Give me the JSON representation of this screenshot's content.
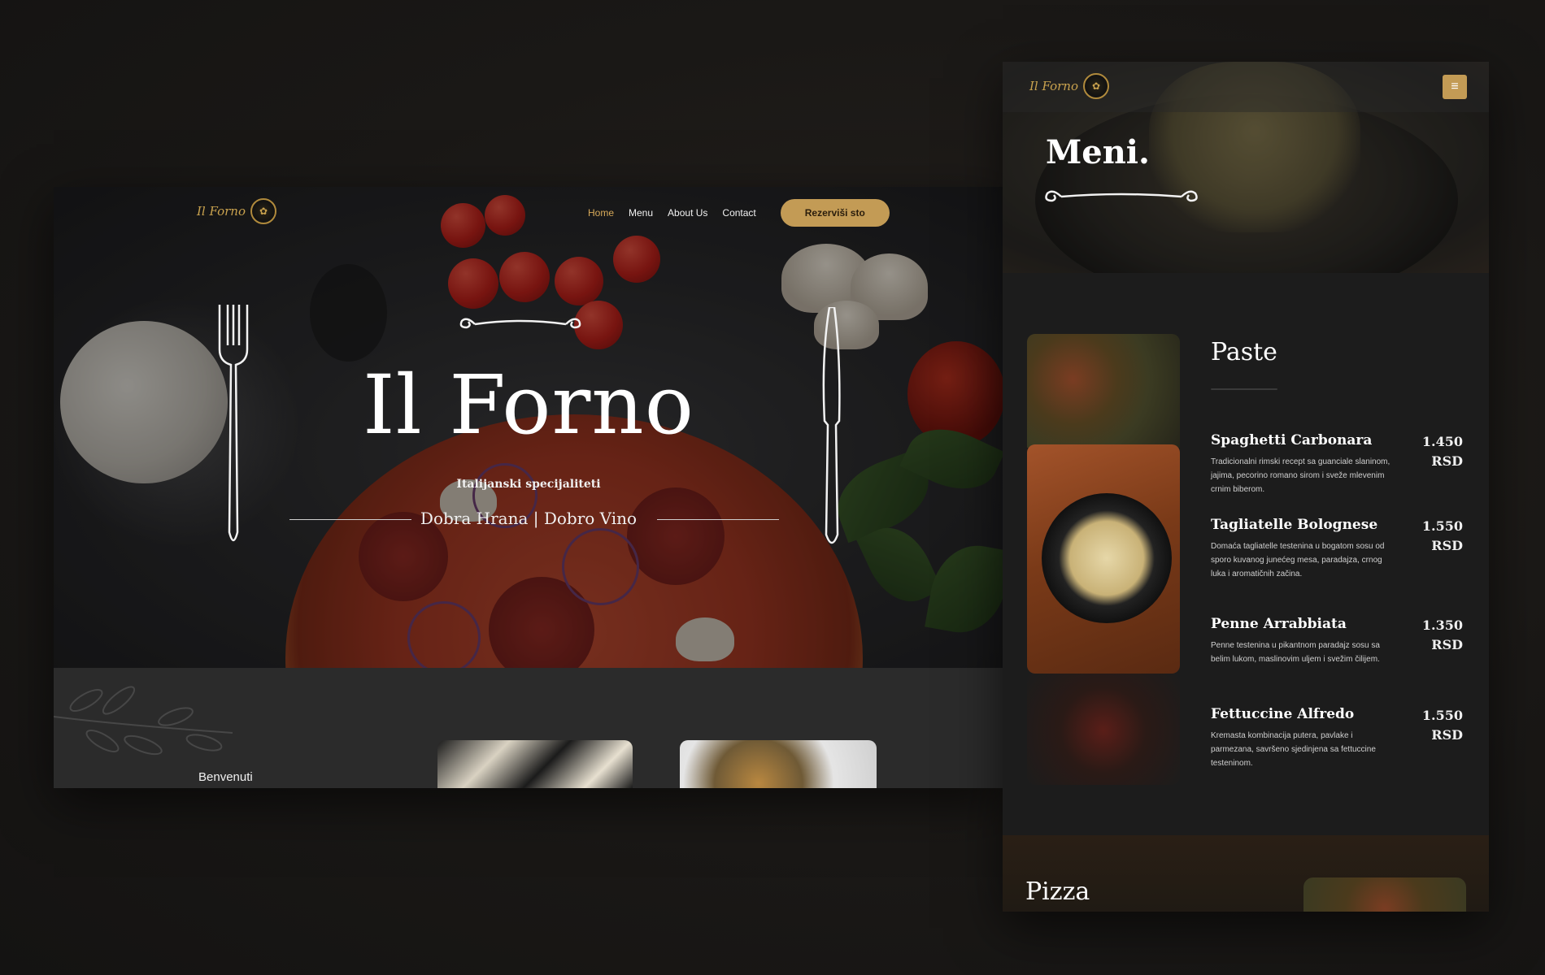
{
  "brand": {
    "logo_text": "Il Forno"
  },
  "desktop": {
    "nav": {
      "items": [
        {
          "label": "Home",
          "active": true
        },
        {
          "label": "Menu",
          "active": false
        },
        {
          "label": "About Us",
          "active": false
        },
        {
          "label": "Contact",
          "active": false
        }
      ],
      "cta_label": "Rezerviši sto"
    },
    "hero": {
      "title": "Il Forno",
      "subtitle": "Italijanski specijaliteti",
      "slogan": "Dobra Hrana | Dobro Vino"
    },
    "welcome": {
      "label": "Benvenuti"
    }
  },
  "mobile": {
    "page_title": "Meni.",
    "menu_button_icon": "hamburger-icon",
    "category": "Paste",
    "items": [
      {
        "name": "Spaghetti Carbonara",
        "desc": "Tradicionalni rimski recept sa guanciale slaninom, jajima, pecorino romano sirom i sveže mlevenim crnim biberom.",
        "price": "1.450",
        "currency": "RSD"
      },
      {
        "name": "Tagliatelle Bolognese",
        "desc": "Domaća tagliatelle testenina u bogatom sosu od sporo kuvanog junećeg mesa, paradajza, crnog luka i aromatičnih začina.",
        "price": "1.550",
        "currency": "RSD"
      },
      {
        "name": "Penne Arrabbiata",
        "desc": "Penne testenina u pikantnom paradajz sosu sa belim lukom, maslinovim uljem i svežim čilijem.",
        "price": "1.350",
        "currency": "RSD"
      },
      {
        "name": "Fettuccine Alfredo",
        "desc": "Kremasta kombinacija putera, pavlake i parmezana, savršeno sjedinjena sa fettuccine testeninom.",
        "price": "1.550",
        "currency": "RSD"
      }
    ],
    "next_category": "Pizza"
  },
  "colors": {
    "accent": "#c39b55",
    "active_nav": "#d8aa5a",
    "background": "#1a1816"
  }
}
